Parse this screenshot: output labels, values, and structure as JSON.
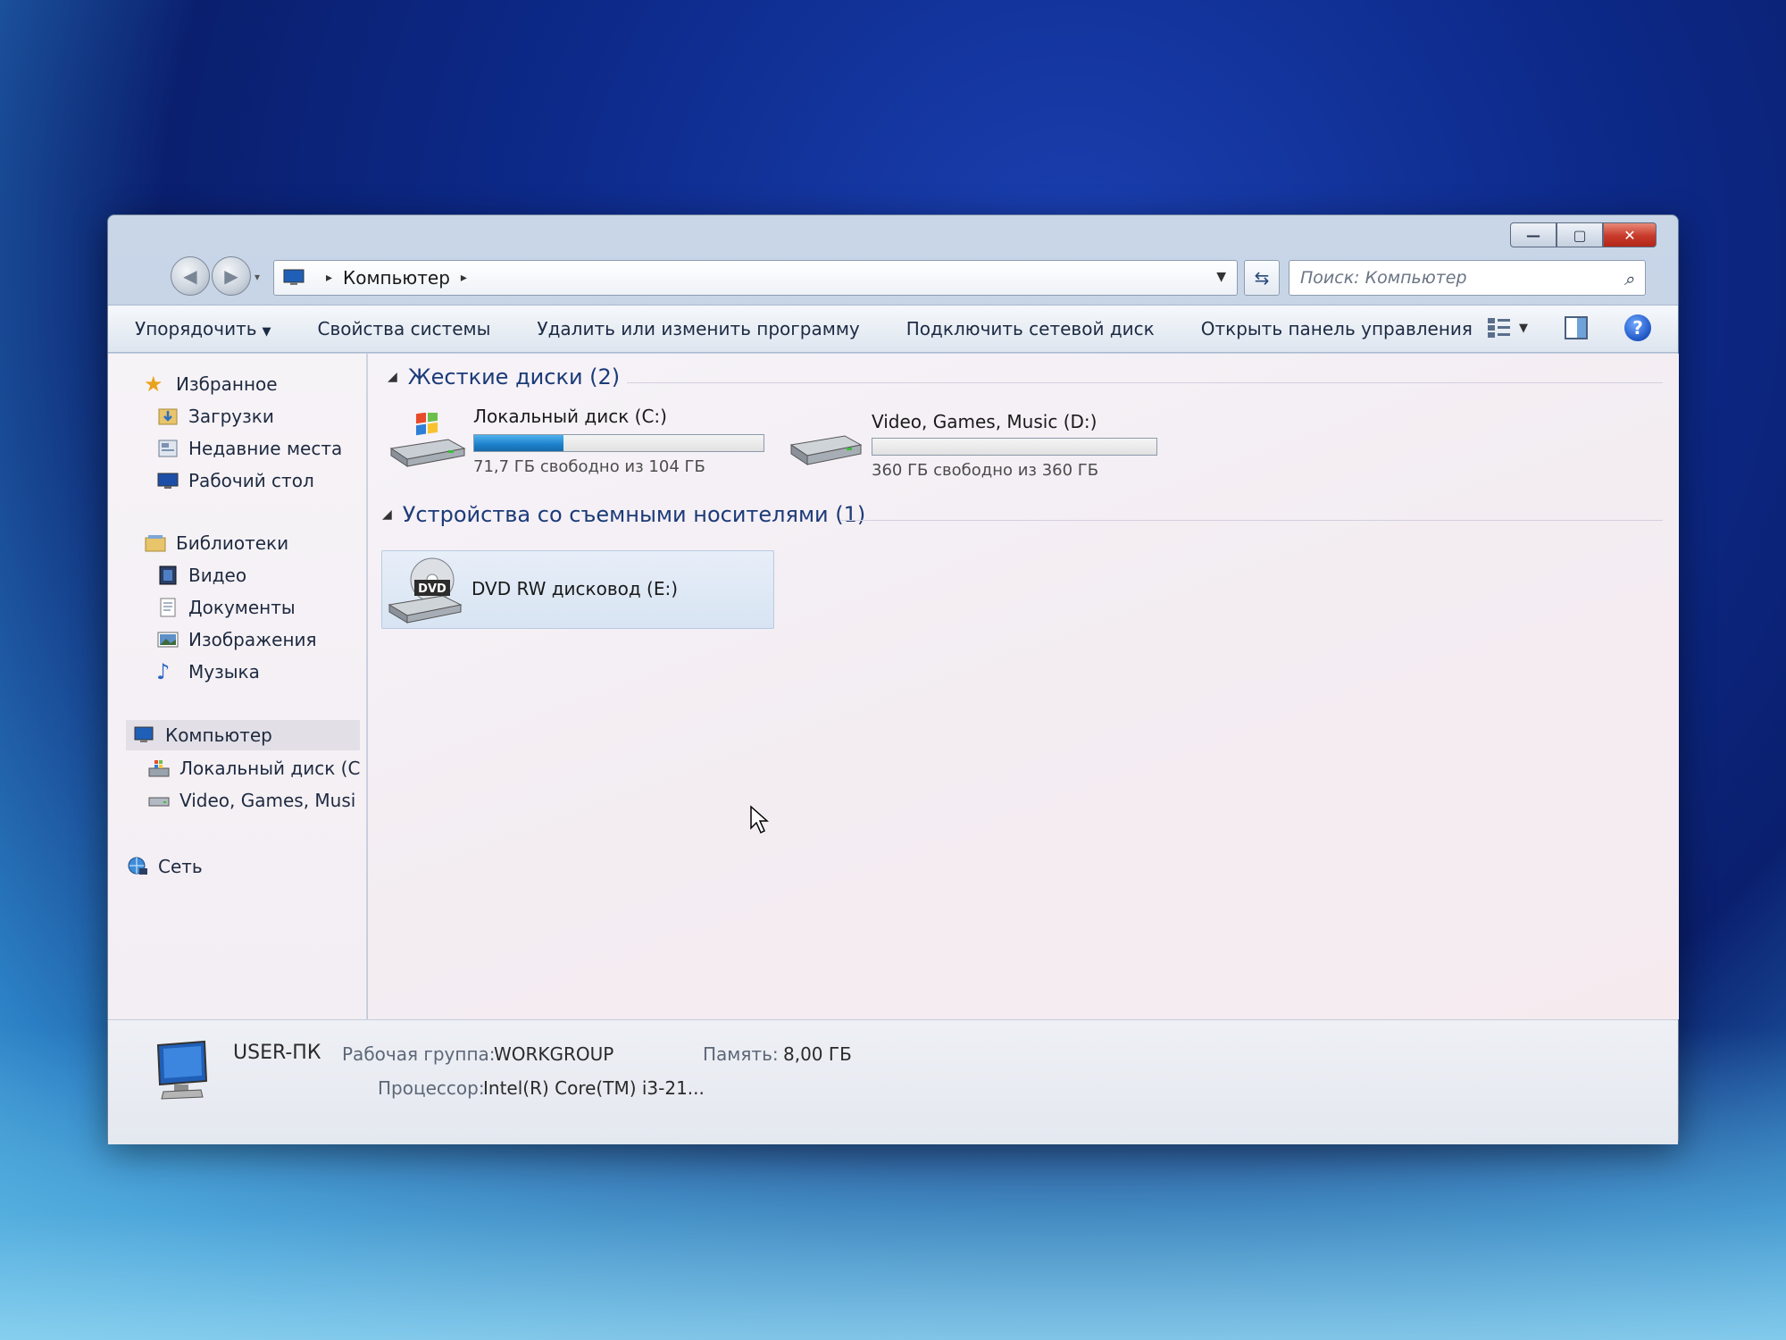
{
  "window": {
    "address": {
      "location": "Компьютер"
    },
    "search_placeholder": "Поиск: Компьютер",
    "controls": {
      "minimize": "—",
      "maximize": "▢",
      "close": "✕"
    }
  },
  "commandbar": {
    "organize": "Упорядочить",
    "system_properties": "Свойства системы",
    "uninstall": "Удалить или изменить программу",
    "map_drive": "Подключить сетевой диск",
    "control_panel": "Открыть панель управления"
  },
  "sidebar": {
    "favorites": {
      "label": "Избранное",
      "items": [
        "Загрузки",
        "Недавние места",
        "Рабочий стол"
      ]
    },
    "libraries": {
      "label": "Библиотеки",
      "items": [
        "Видео",
        "Документы",
        "Изображения",
        "Музыка"
      ]
    },
    "computer": {
      "label": "Компьютер",
      "items": [
        "Локальный диск (C",
        "Video, Games, Musi"
      ]
    },
    "network": {
      "label": "Сеть"
    }
  },
  "content": {
    "hard_drives": {
      "header": "Жесткие диски (2)",
      "drives": [
        {
          "name": "Локальный диск (C:)",
          "free_text": "71,7 ГБ свободно из 104 ГБ",
          "used_fraction": 0.31
        },
        {
          "name": "Video, Games, Music (D:)",
          "free_text": "360 ГБ свободно из 360 ГБ",
          "used_fraction": 0.0
        }
      ]
    },
    "removable": {
      "header": "Устройства со съемными носителями (1)",
      "drives": [
        {
          "name": "DVD RW дисковод (E:)",
          "badge": "DVD"
        }
      ]
    }
  },
  "details": {
    "computer_name": "USER-ПК",
    "workgroup_label": "Рабочая группа:",
    "workgroup_value": "WORKGROUP",
    "memory_label": "Память:",
    "memory_value": "8,00 ГБ",
    "processor_label": "Процессор:",
    "processor_value": "Intel(R) Core(TM) i3-21..."
  },
  "colors": {
    "accent": "#1d80cc",
    "close_button": "#c7392a",
    "header_text": "#1c3b78"
  }
}
